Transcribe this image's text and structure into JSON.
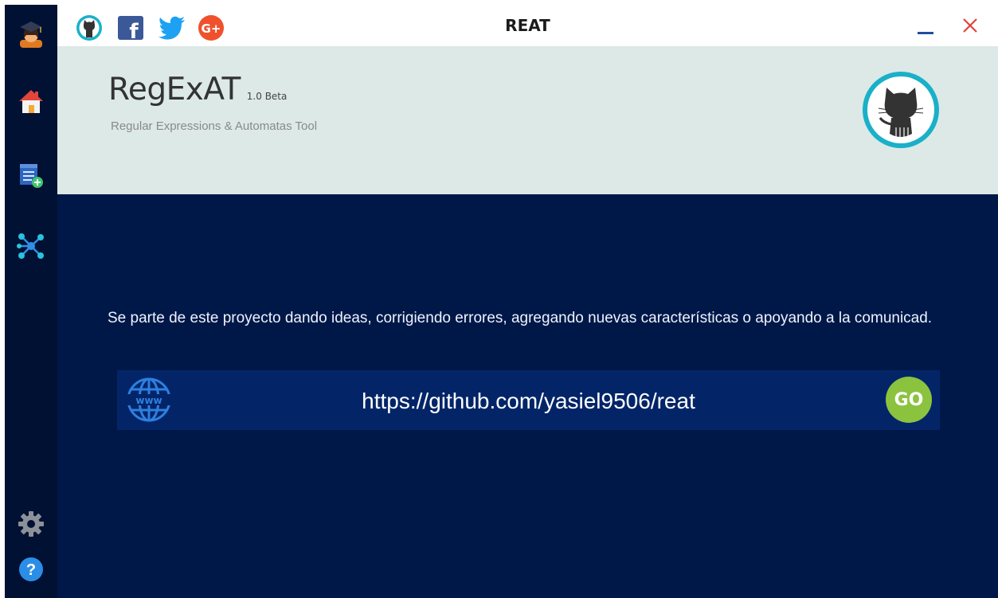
{
  "window": {
    "title": "REAT"
  },
  "sidebar": {
    "items": [
      {
        "name": "user-avatar",
        "icon": "graduate-avatar-icon"
      },
      {
        "name": "home",
        "icon": "home-icon"
      },
      {
        "name": "new-list",
        "icon": "list-add-icon"
      },
      {
        "name": "automata",
        "icon": "network-graph-icon"
      },
      {
        "name": "settings",
        "icon": "gear-icon"
      },
      {
        "name": "help",
        "icon": "help-icon",
        "label": "?"
      }
    ]
  },
  "social": [
    {
      "name": "github",
      "icon": "github-icon"
    },
    {
      "name": "facebook",
      "icon": "facebook-icon",
      "label": "f"
    },
    {
      "name": "twitter",
      "icon": "twitter-icon"
    },
    {
      "name": "google-plus",
      "icon": "google-plus-icon",
      "label": "G+"
    }
  ],
  "header": {
    "app_name": "RegExAT",
    "version": "1.0 Beta",
    "subtitle": "Regular Expressions & Automatas Tool"
  },
  "content": {
    "description": "Se parte de este proyecto dando ideas, corrigiendo errores, agregando nuevas características o apoyando a la comunicad.",
    "url": "https://github.com/yasiel9506/reat",
    "go_label": "GO"
  },
  "colors": {
    "sidebar": "#011133",
    "content_bg": "#001848",
    "link_bar": "#032568",
    "header_bg": "#dce9e7",
    "accent_teal": "#1ab0c8",
    "go_green": "#8bc33f",
    "close_red": "#e0443a",
    "minimize_blue": "#1e4f9c"
  }
}
